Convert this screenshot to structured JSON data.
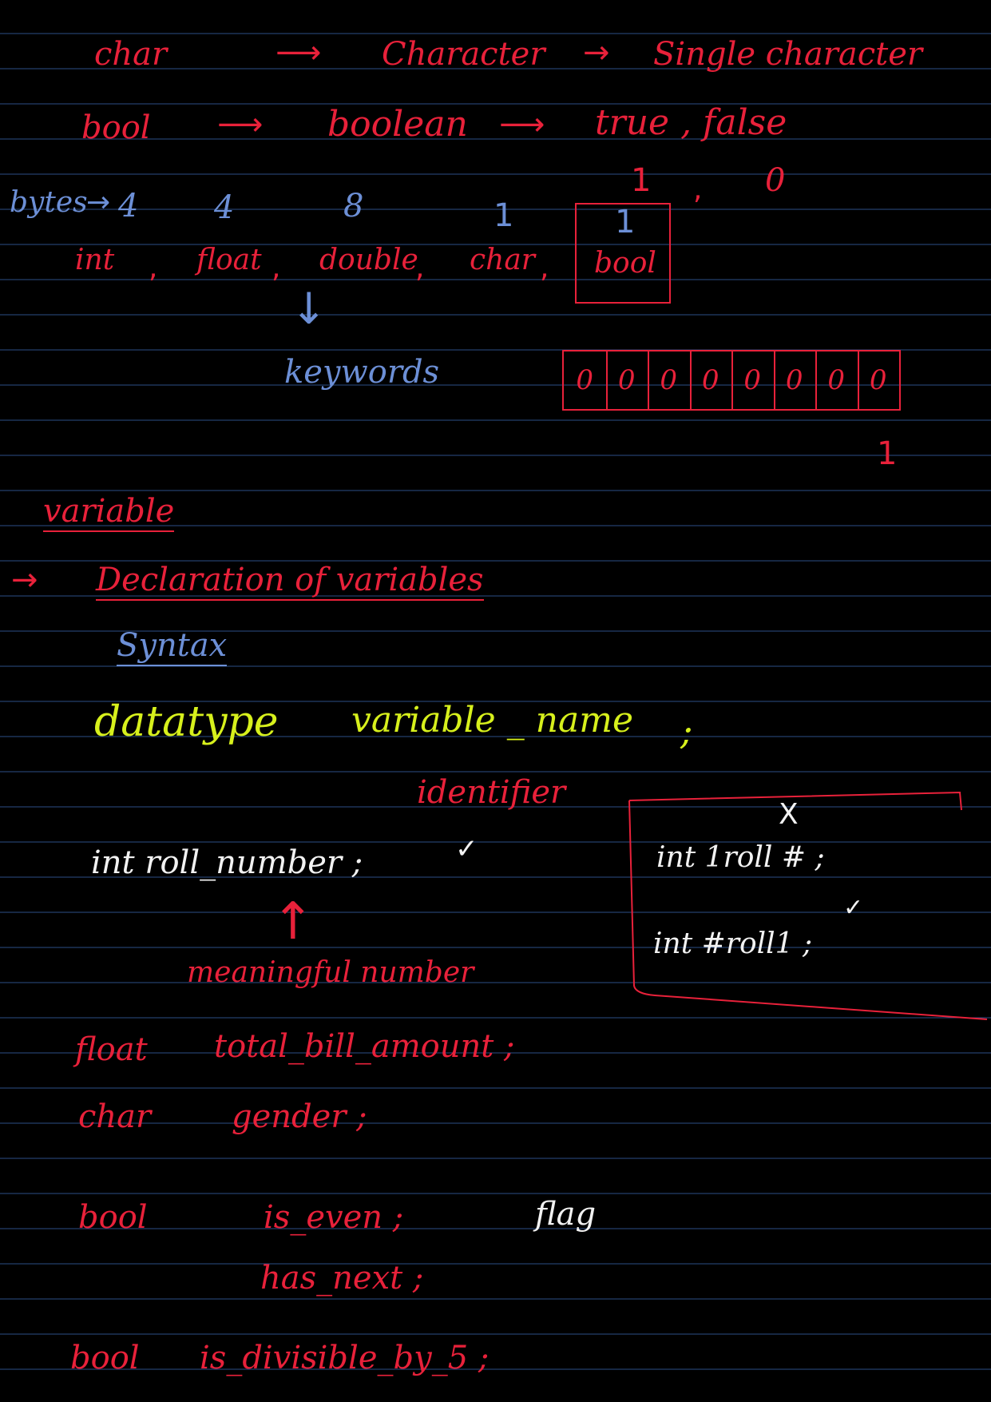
{
  "notes": {
    "row1": {
      "type": "char",
      "arrow1": "⟶",
      "meaning": "Character",
      "arrow2": "→",
      "desc": "Single character"
    },
    "row2": {
      "type": "bool",
      "arrow1": "⟶",
      "meaning": "boolean",
      "arrow2": "⟶",
      "desc": "true , false"
    },
    "bool_values": {
      "one": "1",
      "comma": ",",
      "zero": "0"
    },
    "bytes": {
      "label": "bytes",
      "arrow": "→",
      "int": "4",
      "float": "4",
      "double": "8",
      "char": "1",
      "bool": "1"
    },
    "datatypes": {
      "int": "int",
      "float": "float",
      "double": "double",
      "char": "char",
      "bool": "bool",
      "c1": ",",
      "c2": ",",
      "c3": ",",
      "c4": ","
    },
    "down_arrow": "↓",
    "keywords": "keywords",
    "bits": [
      "0",
      "0",
      "0",
      "0",
      "0",
      "0",
      "0",
      "0"
    ],
    "bit_below": "1",
    "variable_title": "variable",
    "declaration_arrow": "→",
    "declaration": "Declaration of variables",
    "syntax": "Syntax",
    "datatype": "datatype",
    "variable_name": "variable _ name",
    "semicolon": ";",
    "identifier": "identifier",
    "example1": "int roll_number ;",
    "check": "✓",
    "up_arrow": "↑",
    "meaningful": "meaningful number",
    "invalid_mark": "X",
    "invalid1": "int 1roll # ;",
    "valid2": "int #roll1 ;",
    "valid_check": "✓",
    "ex_float_type": "float",
    "ex_float_var": "total_bill_amount ;",
    "ex_char_type": "char",
    "ex_char_var": "gender ;",
    "ex_bool_type": "bool",
    "ex_bool_var1": "is_even ;",
    "flag": "flag",
    "ex_bool_var2": "has_next ;",
    "ex_bool2_type": "bool",
    "ex_bool2_var": "is_divisible_by_5 ;"
  },
  "colors": {
    "ink_red": "#e8213a",
    "ink_blue": "#6c8fd6",
    "ink_yellow": "#d7f01c",
    "ink_white": "#f2f2f2",
    "rule_line": "#2c4e86",
    "background": "#000000"
  }
}
